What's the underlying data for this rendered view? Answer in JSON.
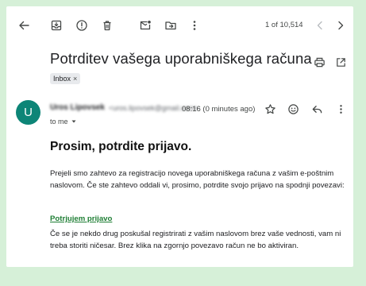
{
  "toolbar": {
    "counter": "1 of 10,514"
  },
  "email": {
    "subject": "Potrditev vašega uporabniškega računa",
    "label": "Inbox",
    "label_remove": "×",
    "avatar_letter": "U",
    "sender_name": "Uros Lipovsek",
    "sender_email": "<uros.lipovsek@gmail.com>",
    "time": "08:16 (0 minutes ago)",
    "recipient": "to me"
  },
  "body": {
    "heading": "Prosim, potrdite prijavo.",
    "paragraph1": "Prejeli smo zahtevo za registracijo novega uporabniškega računa z vašim e-poštnim naslovom. Če ste zahtevo oddali vi, prosimo, potrdite svojo prijavo na spodnji povezavi:",
    "link": "Potrjujem prijavo",
    "paragraph2": "Če se je nekdo drug poskušal registrirati z vašim naslovom brez vaše vednosti, vam ni treba storiti ničesar. Brez klika na zgornjo povezavo račun ne bo aktiviran."
  },
  "colors": {
    "page_background": "#d6f0d8",
    "avatar": "#0d8577",
    "link": "#1e7e34"
  },
  "icons": [
    "back-arrow-icon",
    "archive-icon",
    "report-spam-icon",
    "delete-icon",
    "mark-unread-icon",
    "move-to-icon",
    "more-vertical-icon",
    "chevron-left-icon",
    "chevron-right-icon",
    "print-icon",
    "open-new-window-icon",
    "star-icon",
    "emoji-icon",
    "reply-icon",
    "more-vertical-icon"
  ]
}
